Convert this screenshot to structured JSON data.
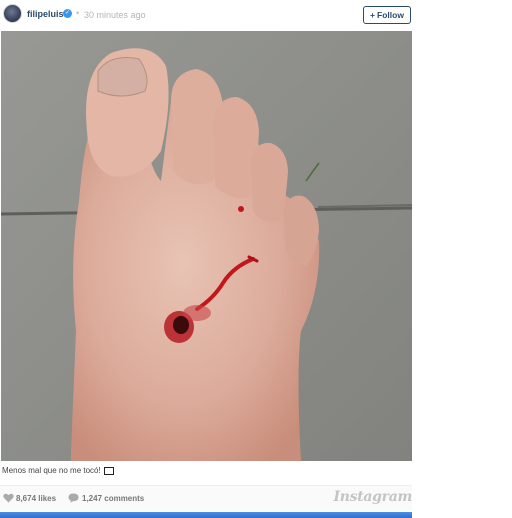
{
  "header": {
    "username": "filipeluis",
    "verified_mark": "✓",
    "separator": "•",
    "time_ago": "30 minutes ago",
    "follow_label": "Follow",
    "follow_plus": "+"
  },
  "caption": {
    "text": "Menos mal que no me tocó!"
  },
  "footer": {
    "likes": "8,674 likes",
    "comments": "1,247 comments",
    "brand": "Instagram"
  },
  "icons": {
    "like": "heart-icon",
    "comment": "comment-bubble-icon",
    "verified": "verified-badge-icon"
  },
  "colors": {
    "link": "#2b4a6f",
    "verified": "#3897f0",
    "muted": "#b5b5b5"
  }
}
